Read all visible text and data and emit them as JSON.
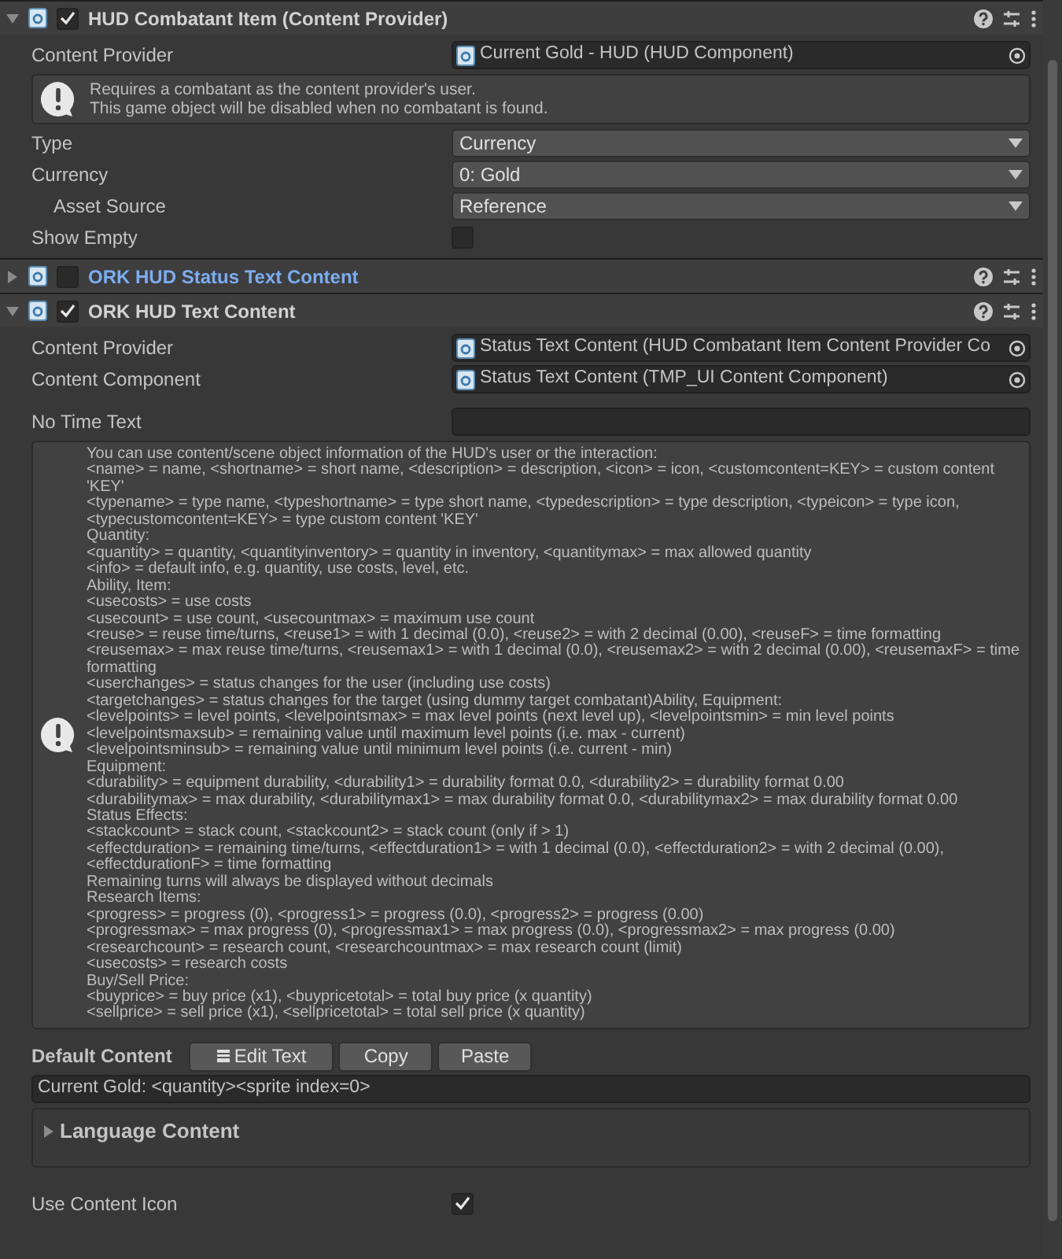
{
  "components": [
    {
      "title": "HUD Combatant Item (Content Provider)",
      "expanded": true,
      "enabled": true,
      "highlighted": false,
      "fields": [
        {
          "kind": "object",
          "label": "Content Provider",
          "value": "Current Gold - HUD (HUD Component)"
        },
        {
          "kind": "help",
          "lines": [
            "Requires a combatant as the content provider's user.",
            "This game object will be disabled when no combatant is found."
          ]
        },
        {
          "kind": "dropdown",
          "label": "Type",
          "value": "Currency",
          "indented": false
        },
        {
          "kind": "dropdown",
          "label": "Currency",
          "value": "0: Gold",
          "indented": false
        },
        {
          "kind": "dropdown",
          "label": "Asset Source",
          "value": "Reference",
          "indented": true
        },
        {
          "kind": "checkbox",
          "label": "Show Empty",
          "checked": false
        }
      ]
    },
    {
      "title": "ORK HUD Status Text Content",
      "expanded": false,
      "enabled": false,
      "highlighted": true
    },
    {
      "title": "ORK HUD Text Content",
      "expanded": true,
      "enabled": true,
      "highlighted": false,
      "fields": [
        {
          "kind": "object",
          "label": "Content Provider",
          "value": "Status Text Content (HUD Combatant Item Content Provider Co"
        },
        {
          "kind": "object",
          "label": "Content Component",
          "value": "Status Text Content (TMP_UI Content Component)"
        },
        {
          "kind": "text",
          "label": "No Time Text"
        },
        {
          "kind": "help",
          "lines": [
            "You can use content/scene object information of the HUD's user or the interaction:",
            "<name> = name, <shortname> = short name, <description> = description, <icon> = icon, <customcontent=KEY> = custom content 'KEY'",
            "<typename> = type name, <typeshortname> = type short name, <typedescription> = type description, <typeicon> = type icon, <typecustomcontent=KEY> = type custom content 'KEY'",
            "Quantity:",
            "<quantity> = quantity, <quantityinventory> = quantity in inventory, <quantitymax> = max allowed quantity",
            "<info> = default info, e.g. quantity, use costs, level, etc.",
            "Ability, Item:",
            "<usecosts> = use costs",
            "<usecount> = use count, <usecountmax> = maximum use count",
            "<reuse> = reuse time/turns, <reuse1> = with 1 decimal (0.0), <reuse2> = with 2 decimal (0.00), <reuseF> = time formatting",
            "<reusemax> = max reuse time/turns, <reusemax1> = with 1 decimal (0.0), <reusemax2> = with 2 decimal (0.00), <reusemaxF> = time formatting",
            "<userchanges> = status changes for the user (including use costs)",
            "<targetchanges> = status changes for the target (using dummy target combatant)Ability, Equipment:",
            "<levelpoints> = level points, <levelpointsmax> = max level points (next level up), <levelpointsmin> = min level points",
            "<levelpointsmaxsub> = remaining value until maximum level points (i.e. max - current)",
            "<levelpointsminsub> = remaining value until minimum level points (i.e. current - min)",
            "Equipment:",
            "<durability> = equipment durability, <durability1> = durability format 0.0, <durability2> = durability format 0.00",
            "<durabilitymax> = max durability, <durabilitymax1> = max durability format 0.0, <durabilitymax2> = max durability format 0.00",
            "Status Effects:",
            "<stackcount> = stack count, <stackcount2> = stack count (only if > 1)",
            "<effectduration> = remaining time/turns, <effectduration1> = with 1 decimal (0.0), <effectduration2> = with 2 decimal (0.00), <effectdurationF> = time formatting",
            "Remaining turns will always be displayed without decimals",
            "Research Items:",
            "<progress> = progress (0), <progress1> = progress (0.0), <progress2> = progress (0.00)",
            "<progressmax> = max progress (0), <progressmax1> = max progress (0.0), <progressmax2> = max progress (0.00)",
            "<researchcount> = research count, <researchcountmax> = max research count (limit)",
            "<usecosts> = research costs",
            "Buy/Sell Price:",
            "<buyprice> = buy price (x1), <buypricetotal> = total buy price (x quantity)",
            "<sellprice> = sell price (x1), <sellpricetotal> = total sell price (x quantity)"
          ]
        },
        {
          "kind": "content",
          "label": "Default Content",
          "buttons": [
            "Edit Text",
            "Copy",
            "Paste"
          ],
          "value": "Current Gold: <quantity><sprite index=0>"
        },
        {
          "kind": "foldout",
          "label": "Language Content",
          "expanded": false
        },
        {
          "kind": "checkbox",
          "label": "Use Content Icon",
          "checked": true
        }
      ]
    }
  ]
}
